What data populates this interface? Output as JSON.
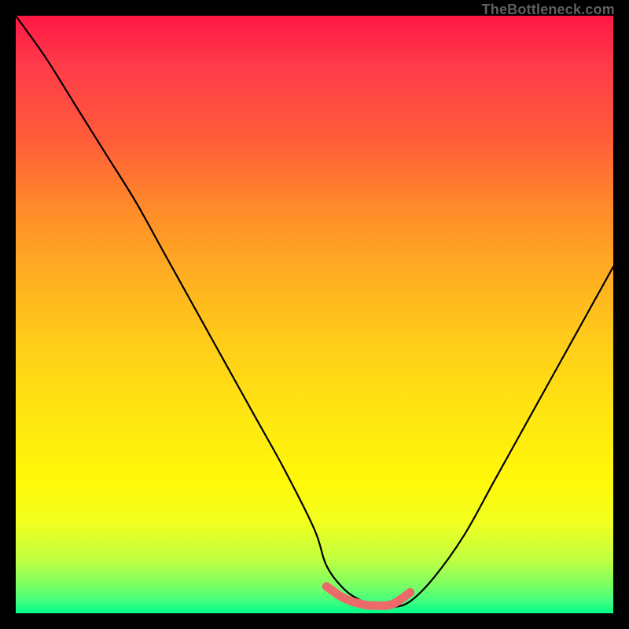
{
  "attribution": "TheBottleneck.com",
  "chart_data": {
    "type": "line",
    "title": "",
    "xlabel": "",
    "ylabel": "",
    "xlim": [
      0,
      100
    ],
    "ylim": [
      0,
      100
    ],
    "series": [
      {
        "name": "bottleneck-curve",
        "x": [
          0,
          5,
          10,
          15,
          20,
          25,
          30,
          35,
          40,
          45,
          50,
          52,
          55,
          58,
          60,
          63,
          66,
          70,
          75,
          80,
          85,
          90,
          95,
          100
        ],
        "y": [
          100,
          93,
          85,
          77,
          69,
          60,
          51,
          42,
          33,
          24,
          14,
          8,
          4,
          2,
          1,
          1,
          2,
          6,
          13,
          22,
          31,
          40,
          49,
          58
        ],
        "color": "#000000"
      },
      {
        "name": "optimal-zone-marker",
        "x": [
          52,
          55,
          58,
          60,
          63,
          66
        ],
        "y": [
          4.5,
          2.5,
          1.5,
          1.3,
          1.5,
          3.5
        ],
        "color": "#e57373"
      }
    ],
    "background_gradient": {
      "top": "#ff1744",
      "mid": "#ffe810",
      "bottom": "#00ff88"
    }
  }
}
